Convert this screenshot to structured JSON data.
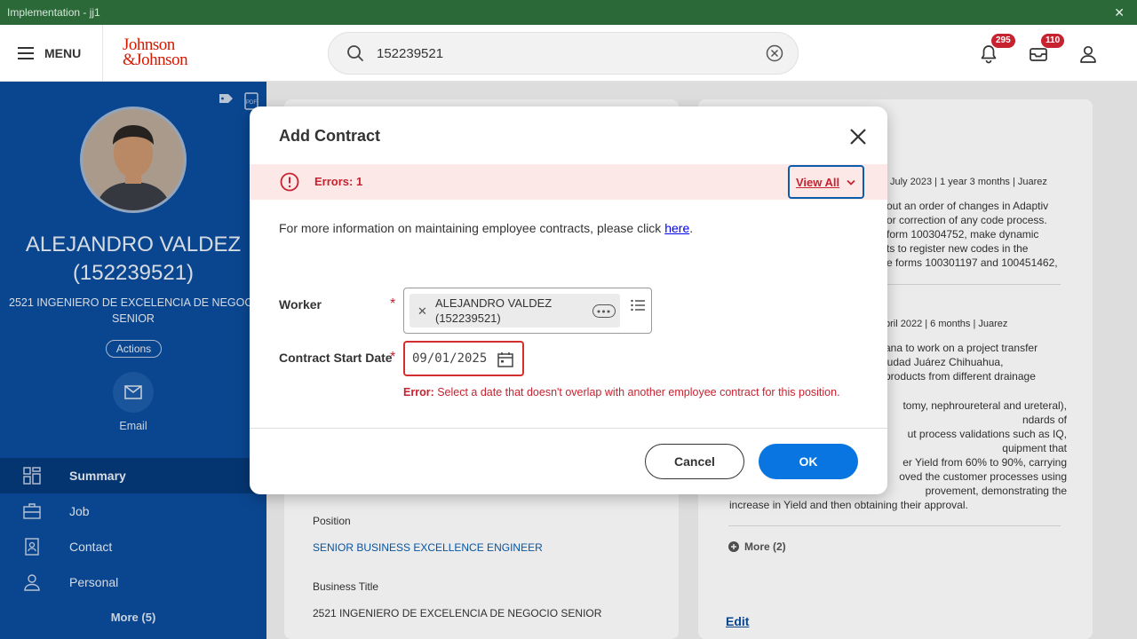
{
  "titlebar": {
    "title": "Implementation - jj1",
    "close": "✕"
  },
  "header": {
    "menu_label": "MENU",
    "logo_line1": "Johnson",
    "logo_line2": "&Johnson",
    "search_value": "152239521",
    "notifications_count": "295",
    "inbox_count": "110"
  },
  "profile": {
    "name_line1": "ALEJANDRO VALDEZ",
    "name_line2": "(152239521)",
    "title_line1": "2521 INGENIERO DE EXCELENCIA DE NEGOCIO",
    "title_line2": "SENIOR",
    "actions_label": "Actions",
    "email_label": "Email"
  },
  "nav": {
    "items": [
      {
        "label": "Summary",
        "icon": "grid-icon",
        "active": true
      },
      {
        "label": "Job",
        "icon": "briefcase-icon"
      },
      {
        "label": "Contact",
        "icon": "contact-book-icon"
      },
      {
        "label": "Personal",
        "icon": "person-icon"
      }
    ],
    "more_label": "More (5)"
  },
  "background": {
    "position_label": "Position",
    "position_value": "SENIOR BUSINESS EXCELLENCE ENGINEER",
    "business_title_label": "Business Title",
    "business_title_value": "2521 INGENIERO DE EXCELENCIA DE NEGOCIO SENIOR",
    "right_line1": "July 2023 | 1 year 3 months | Juarez",
    "right_p1": [
      "out an order of changes in Adaptiv",
      "or correction of any code process.",
      "form 100304752, make dynamic",
      "ts to register new codes in the",
      "e forms 100301197 and 100451462,"
    ],
    "right_line2": "pril 2022 | 6 months | Juarez",
    "right_p2": [
      "ana to work on a project transfer",
      "iudad Juárez Chihuahua,",
      "products from different drainage"
    ],
    "right_p3": [
      "tomy, nephroureteral and ureteral),",
      "ndards of",
      "ut process validations such as IQ,",
      "quipment that",
      "er Yield from 60% to 90%, carrying",
      "oved the customer processes using",
      "provement, demonstrating the",
      "increase in Yield and then obtaining their approval."
    ],
    "more_label": "More (2)",
    "edit_label": "Edit"
  },
  "modal": {
    "title": "Add Contract",
    "error_count": "Errors: 1",
    "view_all": "View All",
    "info_text": "For more information on maintaining employee contracts, please click ",
    "info_link": "here",
    "info_suffix": ".",
    "worker_label": "Worker",
    "worker_line1": "ALEJANDRO VALDEZ",
    "worker_line2": "(152239521)",
    "start_date_label": "Contract Start Date",
    "start_date_value": "09/01/2025",
    "error_prefix": "Error:",
    "error_message": " Select a date that doesn't overlap with another employee contract for this position.",
    "cancel_label": "Cancel",
    "ok_label": "OK",
    "required_mark": "*"
  },
  "colors": {
    "accent": "#0875e1",
    "sidebar": "#0b4c9c",
    "error": "#c6222f",
    "titlebar": "#2b6a38"
  }
}
